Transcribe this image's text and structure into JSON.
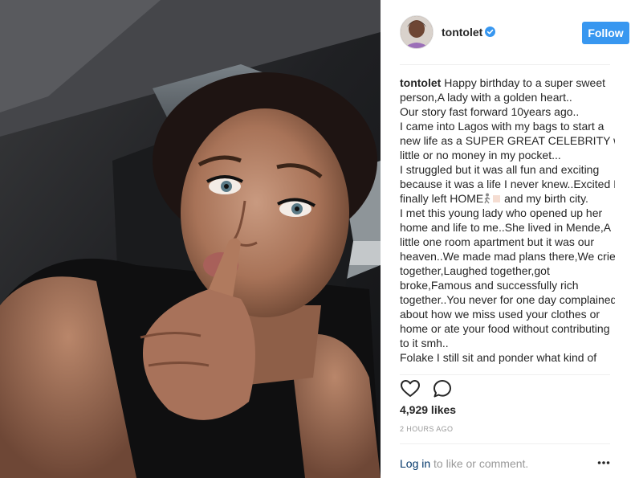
{
  "post": {
    "author": {
      "username": "tontolet",
      "verified": true,
      "follow_label": "Follow"
    },
    "caption": {
      "username": "tontolet",
      "lines": [
        "Happy birthday to a super sweet",
        "person,A lady with a golden heart..",
        "Our story fast forward 10years ago..",
        "I came into Lagos with my bags to start a",
        "new life as a SUPER GREAT CELEBRITY with",
        "little or no money in my pocket...",
        "I struggled but it was all fun and exciting",
        "because it was a life I never knew..Excited I",
        "finally left HOME",
        " and my birth city.",
        "I met this young lady who opened up her",
        "home and life to me..She lived in Mende,A",
        "little one room apartment but it was our",
        "heaven..We made mad plans there,We cried",
        "together,Laughed together,got",
        "broke,Famous and successfully rich",
        "together..You never for one day complained",
        "about how we miss used your clothes or",
        "home or ate your food without contributing",
        "to it smh..",
        "Folake I still sit and ponder what kind of"
      ]
    },
    "likes": "4,929 likes",
    "timestamp": "2 HOURS AGO",
    "comment_bar": {
      "login_label": "Log in",
      "suffix": " to like or comment."
    }
  },
  "colors": {
    "accent": "#3897f0",
    "verified": "#3897f0",
    "link": "#003569",
    "muted": "#999999",
    "text": "#262626"
  },
  "icons": {
    "like": "heart-outline-icon",
    "comment": "speech-bubble-icon",
    "more": "ellipsis-icon",
    "verified": "verified-badge-icon"
  }
}
